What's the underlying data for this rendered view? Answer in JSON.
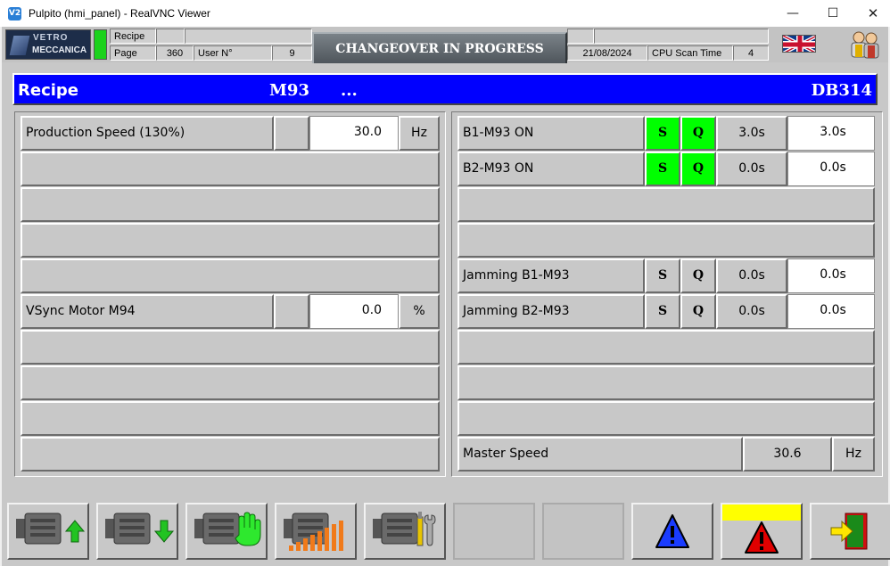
{
  "window": {
    "title": "Pulpito (hmi_panel) - RealVNC Viewer",
    "controls": {
      "minimize": "—",
      "maximize": "☐",
      "close": "✕"
    }
  },
  "header": {
    "logo": {
      "line1": "VETRO",
      "line2": "MECCANICA"
    },
    "recipe_label": "Recipe",
    "recipe_value": "",
    "page_label": "Page",
    "page_value": "360",
    "user_label": "User N°",
    "user_value": "9",
    "banner": "CHANGEOVER IN PROGRESS",
    "date": "21/08/2024",
    "cpu_label": "CPU Scan Time",
    "cpu_value": "4",
    "language_icon": "uk-flag-icon",
    "users_icon": "users-icon"
  },
  "recipe_bar": {
    "title": "Recipe",
    "code": "M93",
    "dots": "...",
    "db": "DB314"
  },
  "left_panel": {
    "rows": [
      {
        "label": "Production Speed (130%)",
        "value": "30.0",
        "unit": "Hz"
      },
      {
        "label": ""
      },
      {
        "label": ""
      },
      {
        "label": ""
      },
      {
        "label": ""
      },
      {
        "label": "VSync Motor M94",
        "value": "0.0",
        "unit": "%"
      },
      {
        "label": ""
      },
      {
        "label": ""
      },
      {
        "label": ""
      },
      {
        "label": ""
      }
    ]
  },
  "right_panel": {
    "rows": [
      {
        "label": "B1-M93 ON",
        "s": "S",
        "q": "Q",
        "s_on": true,
        "q_on": true,
        "actual": "3.0s",
        "setpoint": "3.0s"
      },
      {
        "label": "B2-M93 ON",
        "s": "S",
        "q": "Q",
        "s_on": true,
        "q_on": true,
        "actual": "0.0s",
        "setpoint": "0.0s"
      },
      {
        "label": ""
      },
      {
        "label": ""
      },
      {
        "label": "Jamming B1-M93",
        "s": "S",
        "q": "Q",
        "s_on": false,
        "q_on": false,
        "actual": "0.0s",
        "setpoint": "0.0s"
      },
      {
        "label": "Jamming B2-M93",
        "s": "S",
        "q": "Q",
        "s_on": false,
        "q_on": false,
        "actual": "0.0s",
        "setpoint": "0.0s"
      },
      {
        "label": ""
      },
      {
        "label": ""
      },
      {
        "label": ""
      }
    ],
    "master_speed": {
      "label": "Master Speed",
      "value": "30.6",
      "unit": "Hz"
    }
  },
  "toolbar": {
    "buttons": [
      {
        "icon": "motor-up-icon"
      },
      {
        "icon": "motor-down-icon"
      },
      {
        "icon": "motor-manual-icon"
      },
      {
        "icon": "motor-speed-icon"
      },
      {
        "icon": "motor-tools-icon"
      },
      {
        "icon": ""
      },
      {
        "icon": ""
      },
      {
        "icon": "warning-blue-icon"
      },
      {
        "icon": "alarm-red-icon"
      },
      {
        "icon": "exit-door-icon"
      }
    ]
  },
  "colors": {
    "title_blue": "#0000ff",
    "on_green": "#00ff00",
    "panel_gray": "#c8c8c8",
    "alarm_yellow": "#ffff00"
  }
}
